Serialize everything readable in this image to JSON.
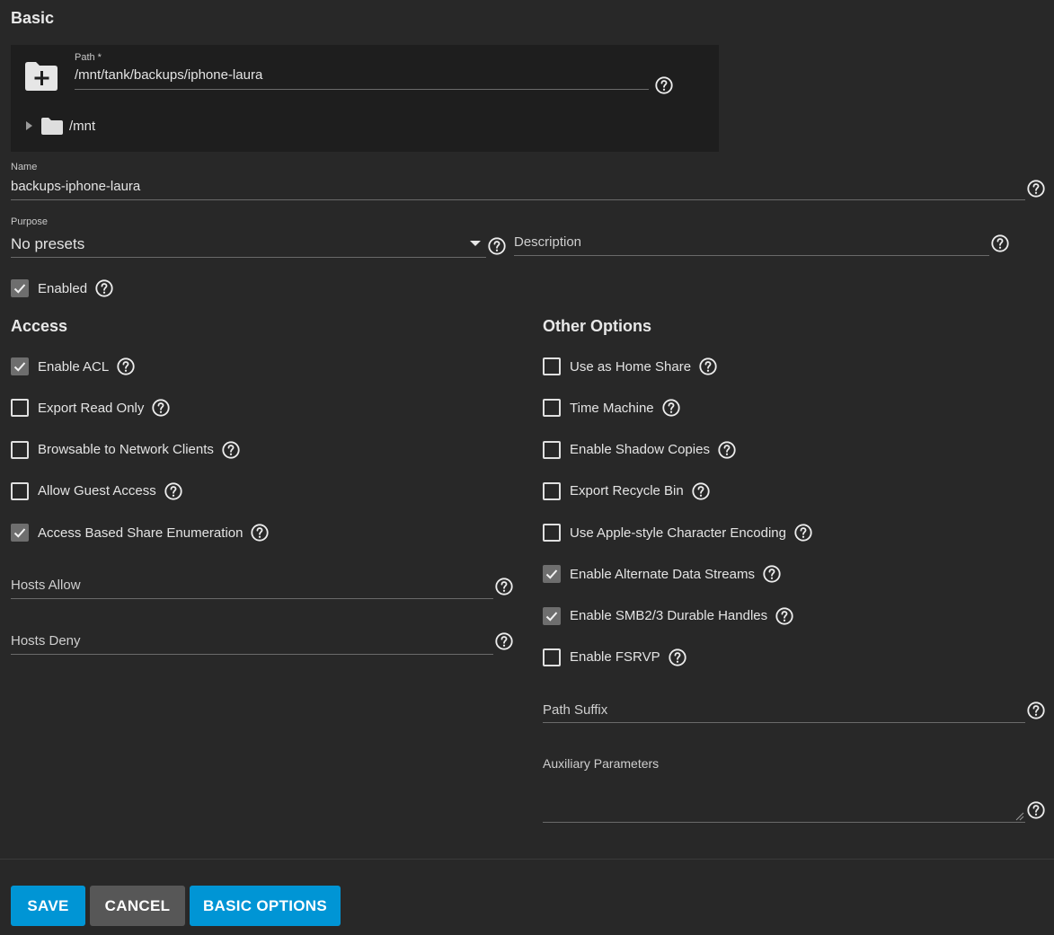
{
  "sections": {
    "basic": "Basic",
    "access": "Access",
    "other": "Other Options"
  },
  "path": {
    "label": "Path *",
    "value": "/mnt/tank/backups/iphone-laura",
    "tree_root": "/mnt"
  },
  "name": {
    "label": "Name",
    "value": "backups-iphone-laura"
  },
  "purpose": {
    "label": "Purpose",
    "value": "No presets"
  },
  "description": {
    "placeholder": "Description"
  },
  "enabled": {
    "label": "Enabled",
    "checked": true
  },
  "access": {
    "options": [
      {
        "label": "Enable ACL",
        "checked": true
      },
      {
        "label": "Export Read Only",
        "checked": false
      },
      {
        "label": "Browsable to Network Clients",
        "checked": false
      },
      {
        "label": "Allow Guest Access",
        "checked": false
      },
      {
        "label": "Access Based Share Enumeration",
        "checked": true
      }
    ],
    "hosts_allow": "Hosts Allow",
    "hosts_deny": "Hosts Deny"
  },
  "other": {
    "options": [
      {
        "label": "Use as Home Share",
        "checked": false
      },
      {
        "label": "Time Machine",
        "checked": false
      },
      {
        "label": "Enable Shadow Copies",
        "checked": false
      },
      {
        "label": "Export Recycle Bin",
        "checked": false
      },
      {
        "label": "Use Apple-style Character Encoding",
        "checked": false
      },
      {
        "label": "Enable Alternate Data Streams",
        "checked": true
      },
      {
        "label": "Enable SMB2/3 Durable Handles",
        "checked": true
      },
      {
        "label": "Enable FSRVP",
        "checked": false
      }
    ],
    "path_suffix": "Path Suffix",
    "aux_params": "Auxiliary Parameters"
  },
  "buttons": {
    "save": "SAVE",
    "cancel": "CANCEL",
    "basic_options": "BASIC OPTIONS"
  },
  "colors": {
    "background": "#282828",
    "panel": "#1e1e1e",
    "primary": "#0095d5",
    "secondary": "#575757",
    "checkbox_checked": "#6e6e6e"
  }
}
